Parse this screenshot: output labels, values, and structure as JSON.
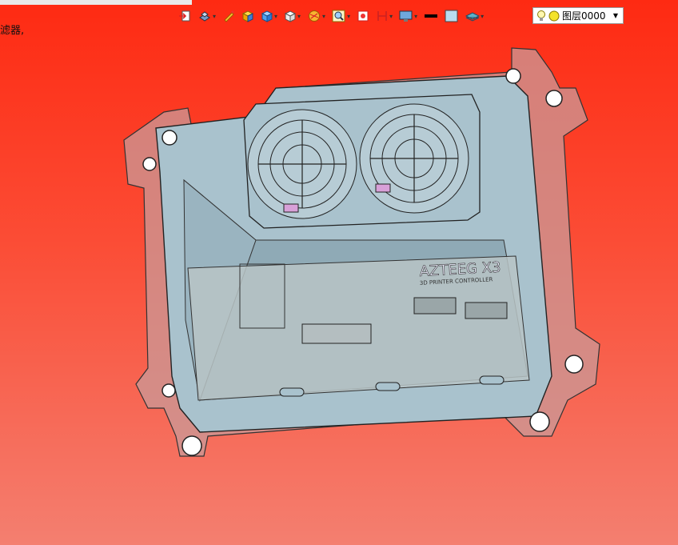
{
  "window": {
    "filter_label": "滤器,"
  },
  "toolbar": {
    "buttons": [
      {
        "id": "extend",
        "icon": "extend-icon",
        "dropdown": false
      },
      {
        "id": "view-cube",
        "icon": "view-orientation-icon",
        "dropdown": true
      },
      {
        "id": "pencil",
        "icon": "pencil-icon",
        "dropdown": false
      },
      {
        "id": "box-shaded",
        "icon": "shaded-box-icon",
        "dropdown": false
      },
      {
        "id": "box-blue",
        "icon": "blue-box-icon",
        "dropdown": true
      },
      {
        "id": "box-white",
        "icon": "wireframe-box-icon",
        "dropdown": true
      },
      {
        "id": "render",
        "icon": "render-style-icon",
        "dropdown": true
      },
      {
        "id": "zoom",
        "icon": "zoom-icon",
        "dropdown": true
      },
      {
        "id": "snapshot",
        "icon": "snapshot-icon",
        "dropdown": false
      },
      {
        "id": "section",
        "icon": "section-icon",
        "dropdown": true
      },
      {
        "id": "display",
        "icon": "display-icon",
        "dropdown": true
      },
      {
        "id": "line-color",
        "icon": "line-color-icon",
        "dropdown": false
      },
      {
        "id": "face-color",
        "icon": "face-color-icon",
        "dropdown": false
      },
      {
        "id": "layer-tool",
        "icon": "layer-tool-icon",
        "dropdown": true
      }
    ]
  },
  "layer": {
    "name": "图层0000",
    "bulb_icon": "bulb-icon",
    "color_icon": "layer-color-icon"
  },
  "model": {
    "brand_text": "AZTEEG X3",
    "sub_text": "3D PRINTER CONTROLLER"
  },
  "colors": {
    "background_top": "#fe2a12",
    "background_bottom": "#f47f70",
    "enclosure": "#a9c2cd",
    "enclosure_dark": "#86a2ae"
  }
}
